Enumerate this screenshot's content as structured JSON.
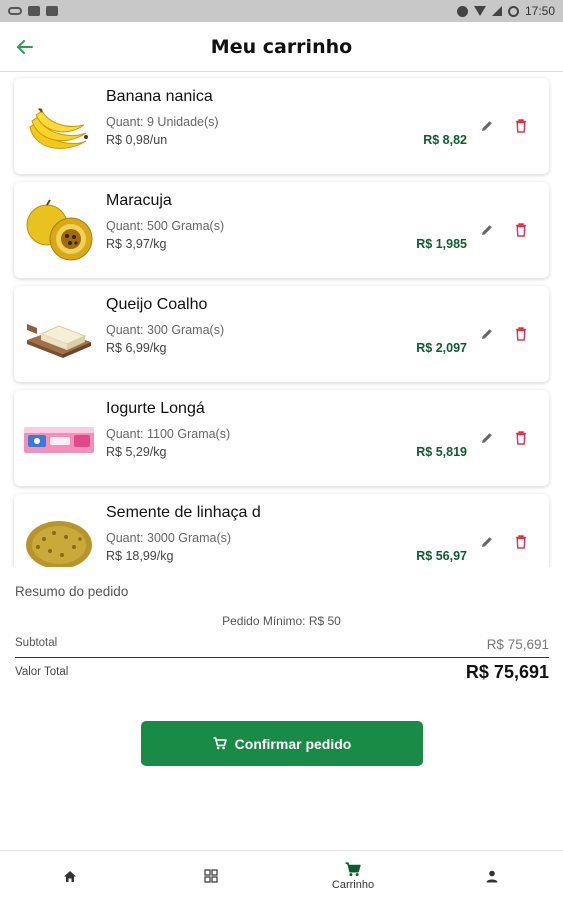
{
  "status_bar": {
    "time": "17:50"
  },
  "header": {
    "title": "Meu carrinho",
    "back_icon": "arrow-left-icon",
    "accent": "#2e9a55"
  },
  "cart": {
    "items": [
      {
        "name": "Banana nanica",
        "quantity": "Quant: 9 Unidade(s)",
        "unit_price": "R$ 0,98/un",
        "total": "R$ 8,82",
        "image": "banana"
      },
      {
        "name": "Maracuja",
        "quantity": "Quant: 500 Grama(s)",
        "unit_price": "R$ 3,97/kg",
        "total": "R$ 1,985",
        "image": "passion-fruit"
      },
      {
        "name": "Queijo Coalho",
        "quantity": "Quant: 300 Grama(s)",
        "unit_price": "R$ 6,99/kg",
        "total": "R$ 2,097",
        "image": "cheese"
      },
      {
        "name": "Iogurte Longá",
        "quantity": "Quant: 1100 Grama(s)",
        "unit_price": "R$ 5,29/kg",
        "total": "R$ 5,819",
        "image": "yogurt-pack"
      },
      {
        "name": "Semente de linhaça d",
        "quantity": "Quant: 3000 Grama(s)",
        "unit_price": "R$ 18,99/kg",
        "total": "R$ 56,97",
        "image": "flaxseed"
      }
    ],
    "price_color": "#0d5c2e",
    "delete_color": "#e0334a"
  },
  "summary": {
    "title": "Resumo do pedido",
    "min_order": "Pedido Mínimo: R$ 50",
    "subtotal_label": "Subtotal",
    "subtotal_value": "R$ 75,691",
    "total_label": "Valor Total",
    "total_value": "R$ 75,691"
  },
  "confirm_button": {
    "label": "Confirmar pedido",
    "icon": "cart-icon",
    "color": "#1a8a47"
  },
  "bottom_nav": {
    "items": [
      {
        "icon": "home-icon",
        "label": ""
      },
      {
        "icon": "grid-icon",
        "label": ""
      },
      {
        "icon": "cart-icon",
        "label": "Carrinho",
        "active": true
      },
      {
        "icon": "person-icon",
        "label": ""
      }
    ]
  }
}
